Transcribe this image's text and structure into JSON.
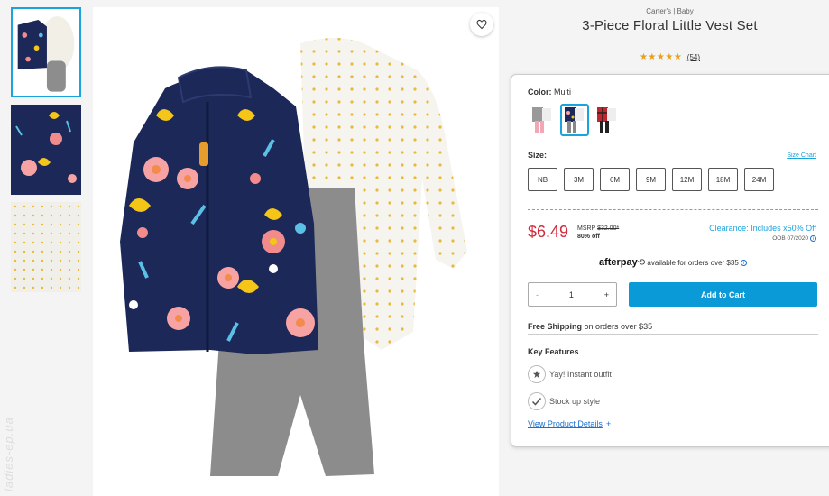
{
  "product": {
    "brand": "Carter's | Baby",
    "title": "3-Piece Floral Little Vest Set",
    "stars": "★★★★★",
    "review_count": "(54)"
  },
  "color": {
    "label": "Color:",
    "value": "Multi",
    "swatches": [
      "pink-gray-set",
      "floral-navy-set",
      "red-plaid-set"
    ],
    "selected_index": 1
  },
  "size": {
    "label": "Size:",
    "chart_link": "Size Chart",
    "options": [
      "NB",
      "3M",
      "6M",
      "9M",
      "12M",
      "18M",
      "24M"
    ]
  },
  "pricing": {
    "price": "$6.49",
    "msrp_label": "MSRP",
    "msrp_value": "$32.00*",
    "discount": "80% off",
    "clearance": "Clearance: Includes x50% Off",
    "oob": "OOB 07/2020"
  },
  "afterpay": {
    "logo": "afterpay",
    "text": "available for orders over $35"
  },
  "quantity": {
    "minus": "-",
    "value": "1",
    "plus": "+"
  },
  "cart": {
    "add_label": "Add to Cart"
  },
  "shipping": {
    "bold": "Free Shipping",
    "rest": "on orders over $35"
  },
  "features": {
    "title": "Key Features",
    "items": [
      "Yay! Instant outfit",
      "Stock up style"
    ],
    "details_link": "View Product Details",
    "details_plus": "+"
  },
  "watermark": "ladies-ep.ua",
  "colors": {
    "accent": "#1aa3dd",
    "cart_button": "#0a9ad8",
    "price": "#d32a3a",
    "star": "#e8a01a",
    "navy": "#1c2857"
  }
}
